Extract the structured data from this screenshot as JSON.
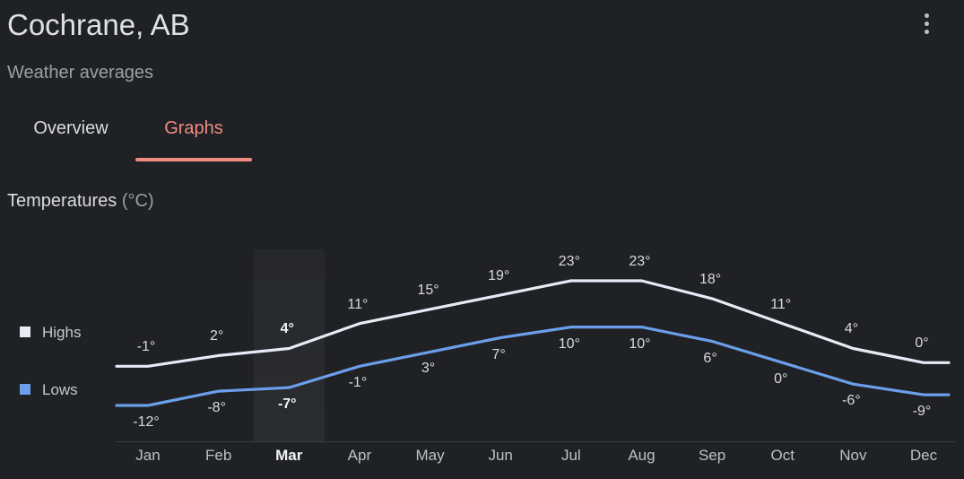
{
  "header": {
    "title": "Cochrane, AB",
    "subtitle": "Weather averages",
    "menu_icon": "kebab-menu-icon"
  },
  "tabs": [
    {
      "label": "Overview",
      "active": false
    },
    {
      "label": "Graphs",
      "active": true
    }
  ],
  "section": {
    "title_main": "Temperatures ",
    "title_unit": "(°C)"
  },
  "legend": [
    {
      "label": "Highs",
      "color": "#e8eaf6"
    },
    {
      "label": "Lows",
      "color": "#6b9eeb"
    }
  ],
  "colors": {
    "background": "#202124",
    "accent": "#f28b82",
    "highs_line": "#e8eaf6",
    "lows_line": "#6b9eeb",
    "axis": "#3c4043",
    "highlight_column": "rgba(232,234,237,0.05)"
  },
  "chart_data": {
    "type": "line",
    "title": "Temperatures (°C)",
    "xlabel": "",
    "ylabel": "°C",
    "categories": [
      "Jan",
      "Feb",
      "Mar",
      "Apr",
      "May",
      "Jun",
      "Jul",
      "Aug",
      "Sep",
      "Oct",
      "Nov",
      "Dec"
    ],
    "highlighted_category": "Mar",
    "ylim": [
      -12,
      23
    ],
    "grid": false,
    "legend_position": "left",
    "series": [
      {
        "name": "Highs",
        "color": "#e8eaf6",
        "values": [
          -1,
          2,
          4,
          11,
          15,
          19,
          23,
          23,
          18,
          11,
          4,
          0
        ],
        "labels": [
          "-1°",
          "2°",
          "4°",
          "11°",
          "15°",
          "19°",
          "23°",
          "23°",
          "18°",
          "11°",
          "4°",
          "0°"
        ]
      },
      {
        "name": "Lows",
        "color": "#6b9eeb",
        "values": [
          -12,
          -8,
          -7,
          -1,
          3,
          7,
          10,
          10,
          6,
          0,
          -6,
          -9
        ],
        "labels": [
          "-12°",
          "-8°",
          "-7°",
          "-1°",
          "3°",
          "7°",
          "10°",
          "10°",
          "6°",
          "0°",
          "-6°",
          "-9°"
        ]
      }
    ]
  }
}
